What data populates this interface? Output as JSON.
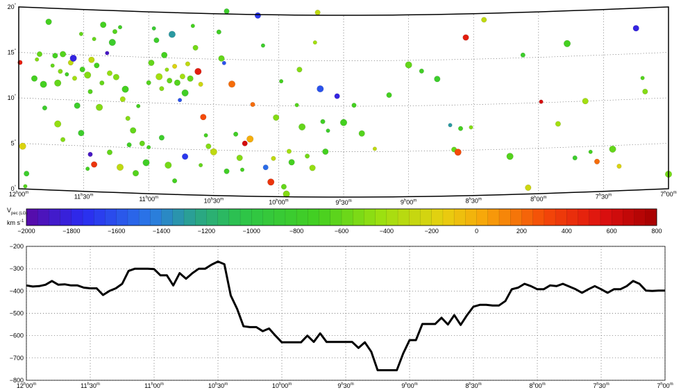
{
  "chart_data": [
    {
      "type": "scatter",
      "projection": "sky map, RA (hours) vs Dec (degrees), curved frame",
      "x_axis": {
        "units": "RA hours",
        "ticks": [
          {
            "value": 12.0,
            "h": "12",
            "m": "00"
          },
          {
            "value": 11.5,
            "h": "11",
            "m": "30"
          },
          {
            "value": 11.0,
            "h": "11",
            "m": "00"
          },
          {
            "value": 10.5,
            "h": "10",
            "m": "30"
          },
          {
            "value": 10.0,
            "h": "10",
            "m": "00"
          },
          {
            "value": 9.5,
            "h": "9",
            "m": "30"
          },
          {
            "value": 9.0,
            "h": "9",
            "m": "00"
          },
          {
            "value": 8.5,
            "h": "8",
            "m": "30"
          },
          {
            "value": 8.0,
            "h": "8",
            "m": "00"
          },
          {
            "value": 7.5,
            "h": "7",
            "m": "30"
          },
          {
            "value": 7.0,
            "h": "7",
            "m": "00"
          }
        ],
        "range": [
          12.0,
          7.0
        ]
      },
      "y_axis": {
        "units": "degrees",
        "ticks": [
          0,
          5,
          10,
          15,
          20
        ],
        "range": [
          0,
          20
        ]
      },
      "grid": true,
      "color_encoding": "Vpec (LG)",
      "points": [
        {
          "ra": 11.95,
          "dec": 0.3,
          "v": -650
        },
        {
          "ra": 11.94,
          "dec": 1.7,
          "v": -800
        },
        {
          "ra": 11.97,
          "dec": 4.7,
          "v": -200
        },
        {
          "ra": 11.99,
          "dec": 13.9,
          "v": 500
        },
        {
          "ra": 11.88,
          "dec": 12.2,
          "v": -700
        },
        {
          "ra": 11.86,
          "dec": 14.3,
          "v": -500
        },
        {
          "ra": 11.84,
          "dec": 14.9,
          "v": -600
        },
        {
          "ra": 11.81,
          "dec": 11.6,
          "v": -700
        },
        {
          "ra": 11.8,
          "dec": 9.0,
          "v": -800
        },
        {
          "ra": 11.77,
          "dec": 18.5,
          "v": -700
        },
        {
          "ra": 11.74,
          "dec": 13.7,
          "v": -600
        },
        {
          "ra": 11.72,
          "dec": 14.8,
          "v": -700
        },
        {
          "ra": 11.7,
          "dec": 11.8,
          "v": -600
        },
        {
          "ra": 11.68,
          "dec": 13.1,
          "v": -500
        },
        {
          "ra": 11.66,
          "dec": 15.0,
          "v": -650
        },
        {
          "ra": 11.63,
          "dec": 12.8,
          "v": -750
        },
        {
          "ra": 11.6,
          "dec": 14.1,
          "v": -300
        },
        {
          "ra": 11.58,
          "dec": 14.6,
          "v": -1800
        },
        {
          "ra": 11.57,
          "dec": 12.4,
          "v": -400
        },
        {
          "ra": 11.55,
          "dec": 9.4,
          "v": -800
        },
        {
          "ra": 11.52,
          "dec": 17.3,
          "v": -600
        },
        {
          "ra": 11.51,
          "dec": 13.4,
          "v": -700
        },
        {
          "ra": 11.47,
          "dec": 12.8,
          "v": -500
        },
        {
          "ra": 11.45,
          "dec": 11.0,
          "v": -650
        },
        {
          "ra": 11.44,
          "dec": 14.5,
          "v": -300
        },
        {
          "ra": 11.42,
          "dec": 16.8,
          "v": -600
        },
        {
          "ra": 11.4,
          "dec": 13.9,
          "v": -700
        },
        {
          "ra": 11.38,
          "dec": 9.3,
          "v": -500
        },
        {
          "ra": 11.36,
          "dec": 12.0,
          "v": -600
        },
        {
          "ra": 11.35,
          "dec": 18.4,
          "v": -700
        },
        {
          "ra": 11.32,
          "dec": 15.3,
          "v": -1900
        },
        {
          "ra": 11.3,
          "dec": 13.1,
          "v": -450
        },
        {
          "ra": 11.28,
          "dec": 16.5,
          "v": -800
        },
        {
          "ra": 11.26,
          "dec": 17.7,
          "v": -650
        },
        {
          "ra": 11.25,
          "dec": 12.7,
          "v": -500
        },
        {
          "ra": 11.22,
          "dec": 18.2,
          "v": -750
        },
        {
          "ra": 11.2,
          "dec": 10.3,
          "v": -400
        },
        {
          "ra": 11.18,
          "dec": 11.4,
          "v": -700
        },
        {
          "ra": 11.16,
          "dec": 8.2,
          "v": -500
        },
        {
          "ra": 11.12,
          "dec": 6.9,
          "v": -600
        },
        {
          "ra": 11.08,
          "dec": 9.6,
          "v": -700
        },
        {
          "ra": 11.05,
          "dec": 5.5,
          "v": -600
        },
        {
          "ra": 11.02,
          "dec": 3.4,
          "v": -750
        },
        {
          "ra": 11.0,
          "dec": 12.2,
          "v": -650
        },
        {
          "ra": 10.98,
          "dec": 14.4,
          "v": -600
        },
        {
          "ra": 10.96,
          "dec": 18.2,
          "v": -850
        },
        {
          "ra": 10.94,
          "dec": 16.9,
          "v": -800
        },
        {
          "ra": 10.92,
          "dec": 12.9,
          "v": -400
        },
        {
          "ra": 10.9,
          "dec": 11.6,
          "v": -500
        },
        {
          "ra": 10.88,
          "dec": 15.3,
          "v": -700
        },
        {
          "ra": 10.86,
          "dec": 13.7,
          "v": -450
        },
        {
          "ra": 10.84,
          "dec": 12.5,
          "v": -600
        },
        {
          "ra": 10.82,
          "dec": 17.6,
          "v": -1300
        },
        {
          "ra": 10.8,
          "dec": 14.1,
          "v": -200
        },
        {
          "ra": 10.78,
          "dec": 12.3,
          "v": -650
        },
        {
          "ra": 10.76,
          "dec": 10.4,
          "v": -1600
        },
        {
          "ra": 10.74,
          "dec": 13.0,
          "v": -400
        },
        {
          "ra": 10.72,
          "dec": 11.2,
          "v": -750
        },
        {
          "ra": 10.7,
          "dec": 14.4,
          "v": -300
        },
        {
          "ra": 10.68,
          "dec": 12.8,
          "v": -600
        },
        {
          "ra": 10.66,
          "dec": 18.6,
          "v": -700
        },
        {
          "ra": 10.64,
          "dec": 16.2,
          "v": -550
        },
        {
          "ra": 10.62,
          "dec": 13.6,
          "v": 500
        },
        {
          "ra": 10.6,
          "dec": 12.2,
          "v": -250
        },
        {
          "ra": 10.58,
          "dec": 8.6,
          "v": 300
        },
        {
          "ra": 10.56,
          "dec": 6.6,
          "v": -700
        },
        {
          "ra": 10.54,
          "dec": 5.4,
          "v": -500
        },
        {
          "ra": 10.5,
          "dec": 4.8,
          "v": -300
        },
        {
          "ra": 10.46,
          "dec": 18.0,
          "v": -750
        },
        {
          "ra": 10.44,
          "dec": 15.1,
          "v": -600
        },
        {
          "ra": 10.42,
          "dec": 14.6,
          "v": -1600
        },
        {
          "ra": 10.4,
          "dec": 20.3,
          "v": -800
        },
        {
          "ra": 10.36,
          "dec": 12.3,
          "v": 200
        },
        {
          "ra": 10.33,
          "dec": 6.8,
          "v": -750
        },
        {
          "ra": 10.3,
          "dec": 4.2,
          "v": -500
        },
        {
          "ra": 10.28,
          "dec": 2.9,
          "v": -700
        },
        {
          "ra": 10.26,
          "dec": 5.8,
          "v": 600
        },
        {
          "ra": 10.22,
          "dec": 6.3,
          "v": 0
        },
        {
          "ra": 10.2,
          "dec": 10.1,
          "v": 200
        },
        {
          "ra": 10.16,
          "dec": 19.9,
          "v": -1700
        },
        {
          "ra": 10.12,
          "dec": 16.6,
          "v": -800
        },
        {
          "ra": 10.1,
          "dec": 3.2,
          "v": -1500
        },
        {
          "ra": 10.06,
          "dec": 1.6,
          "v": 400
        },
        {
          "ra": 10.04,
          "dec": 4.2,
          "v": -300
        },
        {
          "ra": 10.02,
          "dec": 8.7,
          "v": -500
        },
        {
          "ra": 9.98,
          "dec": 12.7,
          "v": -700
        },
        {
          "ra": 9.96,
          "dec": 1.1,
          "v": -600
        },
        {
          "ra": 9.94,
          "dec": 0.3,
          "v": -500
        },
        {
          "ra": 9.92,
          "dec": 5.0,
          "v": -400
        },
        {
          "ra": 9.9,
          "dec": 3.8,
          "v": -700
        },
        {
          "ra": 9.86,
          "dec": 10.1,
          "v": -650
        },
        {
          "ra": 9.84,
          "dec": 14.0,
          "v": -500
        },
        {
          "ra": 9.82,
          "dec": 7.7,
          "v": -600
        },
        {
          "ra": 9.78,
          "dec": 4.5,
          "v": -550
        },
        {
          "ra": 9.74,
          "dec": 3.2,
          "v": -450
        },
        {
          "ra": 9.72,
          "dec": 17.0,
          "v": -400
        },
        {
          "ra": 9.7,
          "dec": 20.3,
          "v": -300
        },
        {
          "ra": 9.68,
          "dec": 11.9,
          "v": -1600
        },
        {
          "ra": 9.66,
          "dec": 8.3,
          "v": -750
        },
        {
          "ra": 9.64,
          "dec": 5.0,
          "v": -700
        },
        {
          "ra": 9.62,
          "dec": 7.3,
          "v": -800
        },
        {
          "ra": 9.55,
          "dec": 11.1,
          "v": -1800
        },
        {
          "ra": 9.5,
          "dec": 8.2,
          "v": -700
        },
        {
          "ra": 9.42,
          "dec": 10.1,
          "v": -700
        },
        {
          "ra": 9.36,
          "dec": 7.0,
          "v": -650
        },
        {
          "ra": 9.26,
          "dec": 5.3,
          "v": -300
        },
        {
          "ra": 9.15,
          "dec": 11.2,
          "v": -700
        },
        {
          "ra": 9.0,
          "dec": 14.5,
          "v": -600
        },
        {
          "ra": 8.9,
          "dec": 13.8,
          "v": -750
        },
        {
          "ra": 8.78,
          "dec": 12.9,
          "v": -800
        },
        {
          "ra": 8.68,
          "dec": 7.8,
          "v": -1300
        },
        {
          "ra": 8.65,
          "dec": 5.1,
          "v": -600
        },
        {
          "ra": 8.62,
          "dec": 4.8,
          "v": 300
        },
        {
          "ra": 8.6,
          "dec": 7.4,
          "v": -700
        },
        {
          "ra": 8.56,
          "dec": 17.4,
          "v": 500
        },
        {
          "ra": 8.52,
          "dec": 7.5,
          "v": -500
        },
        {
          "ra": 8.42,
          "dec": 19.3,
          "v": -300
        },
        {
          "ra": 8.22,
          "dec": 4.2,
          "v": -650
        },
        {
          "ra": 8.12,
          "dec": 15.3,
          "v": -800
        },
        {
          "ra": 8.08,
          "dec": 0.7,
          "v": -250
        },
        {
          "ra": 7.98,
          "dec": 10.1,
          "v": 600
        },
        {
          "ra": 7.85,
          "dec": 7.6,
          "v": -400
        },
        {
          "ra": 7.78,
          "dec": 16.4,
          "v": -700
        },
        {
          "ra": 7.72,
          "dec": 3.8,
          "v": -800
        },
        {
          "ra": 7.64,
          "dec": 10.0,
          "v": -400
        },
        {
          "ra": 7.6,
          "dec": 4.4,
          "v": -700
        },
        {
          "ra": 7.55,
          "dec": 3.3,
          "v": 200
        },
        {
          "ra": 7.43,
          "dec": 4.6,
          "v": -600
        },
        {
          "ra": 7.38,
          "dec": 2.7,
          "v": -200
        },
        {
          "ra": 7.25,
          "dec": 17.8,
          "v": -1800
        },
        {
          "ra": 7.2,
          "dec": 12.3,
          "v": -650
        },
        {
          "ra": 7.18,
          "dec": 10.8,
          "v": -500
        },
        {
          "ra": 7.0,
          "dec": 1.6,
          "v": -550
        },
        {
          "ra": 11.45,
          "dec": 4.1,
          "v": -1900
        },
        {
          "ra": 11.42,
          "dec": 3.0,
          "v": 400
        },
        {
          "ra": 11.47,
          "dec": 2.5,
          "v": -700
        },
        {
          "ra": 11.3,
          "dec": 4.4,
          "v": -600
        },
        {
          "ra": 11.22,
          "dec": 2.8,
          "v": -300
        },
        {
          "ra": 11.15,
          "dec": 5.3,
          "v": -750
        },
        {
          "ra": 11.1,
          "dec": 2.2,
          "v": -650
        },
        {
          "ra": 11.0,
          "dec": 5.1,
          "v": -700
        },
        {
          "ra": 10.9,
          "dec": 6.2,
          "v": -800
        },
        {
          "ra": 10.85,
          "dec": 3.2,
          "v": -550
        },
        {
          "ra": 10.8,
          "dec": 1.5,
          "v": -700
        },
        {
          "ra": 10.72,
          "dec": 4.2,
          "v": -1700
        },
        {
          "ra": 10.6,
          "dec": 3.3,
          "v": -600
        },
        {
          "ra": 10.4,
          "dec": 2.7,
          "v": -750
        },
        {
          "ra": 11.7,
          "dec": 7.3,
          "v": -450
        },
        {
          "ra": 11.66,
          "dec": 5.6,
          "v": -500
        },
        {
          "ra": 11.52,
          "dec": 6.4,
          "v": -800
        }
      ]
    },
    {
      "type": "colorbar",
      "label_main": "V",
      "label_sub": "pec (LG)",
      "units_main": "km s",
      "units_exp": "-1",
      "range": [
        -2000,
        800
      ],
      "ticks": [
        -2000,
        -1800,
        -1600,
        -1400,
        -1200,
        -1000,
        -800,
        -600,
        -400,
        -200,
        0,
        200,
        400,
        600,
        800
      ],
      "stops": [
        {
          "v": -2000,
          "color": "#5a0aa6"
        },
        {
          "v": -1750,
          "color": "#2a2bf0"
        },
        {
          "v": -1450,
          "color": "#2a78e6"
        },
        {
          "v": -1250,
          "color": "#2aa48a"
        },
        {
          "v": -1050,
          "color": "#2cc44a"
        },
        {
          "v": -700,
          "color": "#44d020"
        },
        {
          "v": -420,
          "color": "#9ee010"
        },
        {
          "v": -150,
          "color": "#e8d010"
        },
        {
          "v": 30,
          "color": "#f7a70a"
        },
        {
          "v": 300,
          "color": "#f44a08"
        },
        {
          "v": 560,
          "color": "#dd1010"
        },
        {
          "v": 800,
          "color": "#a40000"
        }
      ]
    },
    {
      "type": "line",
      "x_range": [
        12.0,
        7.0
      ],
      "ylim": [
        -800,
        -200
      ],
      "y_ticks": [
        -200,
        -300,
        -400,
        -500,
        -600,
        -700,
        -800
      ],
      "x_ticks": [
        {
          "value": 12.0,
          "h": "12",
          "m": "00"
        },
        {
          "value": 11.5,
          "h": "11",
          "m": "30"
        },
        {
          "value": 11.0,
          "h": "11",
          "m": "00"
        },
        {
          "value": 10.5,
          "h": "10",
          "m": "30"
        },
        {
          "value": 10.0,
          "h": "10",
          "m": "00"
        },
        {
          "value": 9.5,
          "h": "9",
          "m": "30"
        },
        {
          "value": 9.0,
          "h": "9",
          "m": "00"
        },
        {
          "value": 8.5,
          "h": "8",
          "m": "30"
        },
        {
          "value": 8.0,
          "h": "8",
          "m": "00"
        },
        {
          "value": 7.5,
          "h": "7",
          "m": "30"
        },
        {
          "value": 7.0,
          "h": "7",
          "m": "00"
        }
      ],
      "grid": true,
      "x": [
        12.0,
        11.95,
        11.9,
        11.85,
        11.8,
        11.75,
        11.7,
        11.65,
        11.6,
        11.55,
        11.5,
        11.45,
        11.4,
        11.35,
        11.3,
        11.25,
        11.2,
        11.15,
        11.1,
        11.05,
        11.0,
        10.95,
        10.9,
        10.85,
        10.8,
        10.75,
        10.7,
        10.65,
        10.6,
        10.55,
        10.5,
        10.45,
        10.4,
        10.35,
        10.3,
        10.25,
        10.2,
        10.15,
        10.1,
        10.05,
        10.0,
        9.95,
        9.9,
        9.85,
        9.8,
        9.75,
        9.7,
        9.65,
        9.6,
        9.55,
        9.5,
        9.45,
        9.4,
        9.35,
        9.3,
        9.25,
        9.2,
        9.15,
        9.1,
        9.05,
        9.0,
        8.95,
        8.9,
        8.85,
        8.8,
        8.75,
        8.7,
        8.65,
        8.6,
        8.55,
        8.5,
        8.45,
        8.4,
        8.35,
        8.3,
        8.25,
        8.2,
        8.15,
        8.1,
        8.05,
        8.0,
        7.95,
        7.9,
        7.85,
        7.8,
        7.75,
        7.7,
        7.65,
        7.6,
        7.55,
        7.5,
        7.45,
        7.4,
        7.35,
        7.3,
        7.25,
        7.2,
        7.15,
        7.1,
        7.05,
        7.0
      ],
      "y": [
        -375,
        -380,
        -378,
        -372,
        -355,
        -372,
        -370,
        -375,
        -375,
        -385,
        -388,
        -388,
        -418,
        -400,
        -388,
        -368,
        -310,
        -300,
        -300,
        -300,
        -302,
        -330,
        -330,
        -375,
        -320,
        -345,
        -320,
        -300,
        -300,
        -282,
        -268,
        -280,
        -420,
        -480,
        -558,
        -562,
        -562,
        -580,
        -568,
        -600,
        -630,
        -630,
        -630,
        -630,
        -600,
        -628,
        -590,
        -628,
        -628,
        -628,
        -628,
        -628,
        -655,
        -630,
        -672,
        -755,
        -755,
        -755,
        -755,
        -680,
        -620,
        -620,
        -548,
        -548,
        -548,
        -520,
        -550,
        -508,
        -552,
        -508,
        -470,
        -462,
        -462,
        -465,
        -465,
        -445,
        -392,
        -385,
        -368,
        -378,
        -392,
        -392,
        -375,
        -378,
        -368,
        -380,
        -392,
        -408,
        -392,
        -378,
        -392,
        -408,
        -392,
        -392,
        -378,
        -355,
        -368,
        -398,
        -400,
        -398,
        -398
      ]
    }
  ]
}
